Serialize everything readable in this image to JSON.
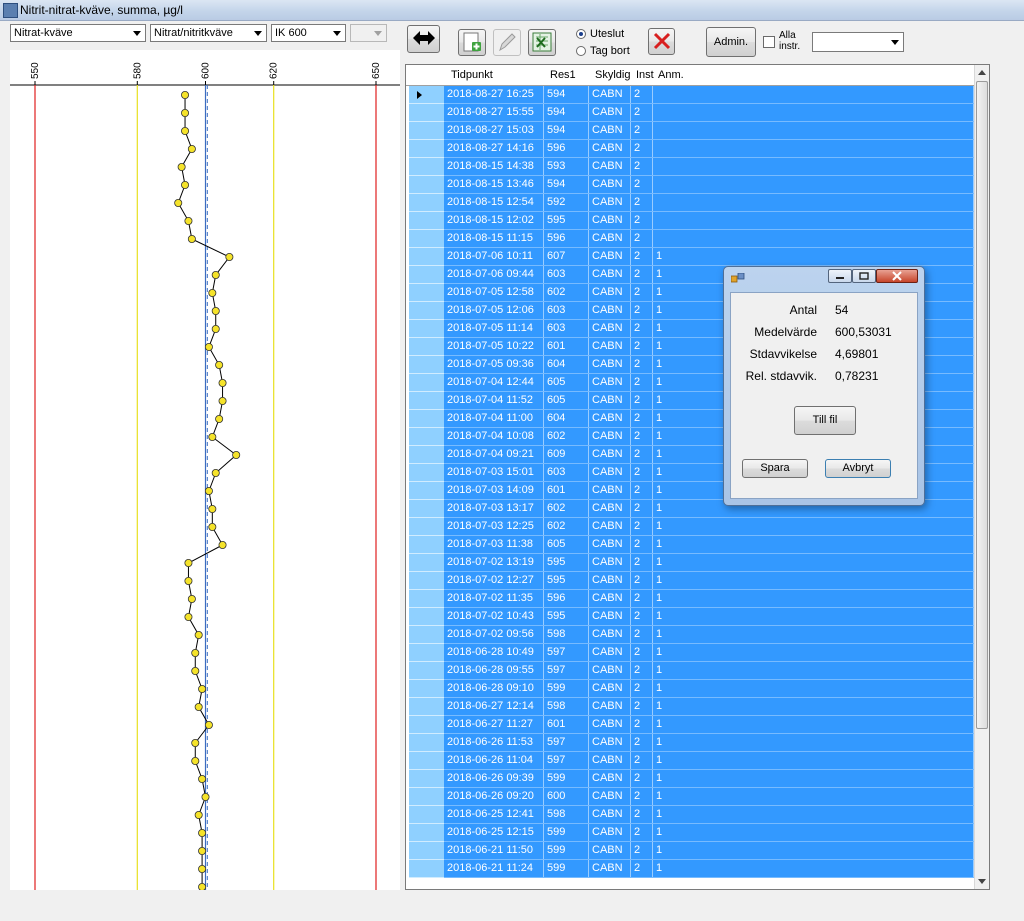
{
  "window": {
    "title": "Nitrit-nitrat-kväve, summa, µg/l"
  },
  "toolbar": {
    "combo1": "Nitrat-kväve",
    "combo2": "Nitrat/nitritkväve",
    "combo3": "IK 600",
    "combo4": "",
    "radio_exclude": "Uteslut",
    "radio_delete": "Tag bort",
    "admin_label": "Admin.",
    "all_instr_label": "Alla instr.",
    "combo5": ""
  },
  "chart_data": {
    "type": "line",
    "orientation": "vertical",
    "x_ticks": [
      "550",
      "580",
      "600",
      "620",
      "650"
    ],
    "xlim": [
      550,
      650
    ],
    "limit_lines": [
      {
        "value": 550,
        "color": "#e02020"
      },
      {
        "value": 580,
        "color": "#e8e020"
      },
      {
        "value": 620,
        "color": "#e8e020"
      },
      {
        "value": 650,
        "color": "#e02020"
      }
    ],
    "target_line": {
      "value": 600,
      "color": "#3b6cc0"
    },
    "mean_line": {
      "value": 600.53,
      "color": "#3b6cc0"
    },
    "point_color": "#f5e32a",
    "values": [
      594,
      594,
      594,
      596,
      593,
      594,
      592,
      595,
      596,
      607,
      603,
      602,
      603,
      603,
      601,
      604,
      605,
      605,
      604,
      602,
      609,
      603,
      601,
      602,
      602,
      605,
      595,
      595,
      596,
      595,
      598,
      597,
      597,
      599,
      598,
      601,
      597,
      597,
      599,
      600,
      598,
      599,
      599,
      599,
      599
    ]
  },
  "grid": {
    "columns": [
      "Tidpunkt",
      "Res1",
      "Skyldig",
      "Inst",
      "Anm."
    ],
    "rows": [
      [
        "2018-08-27 16:25",
        "594",
        "CABN",
        "2",
        ""
      ],
      [
        "2018-08-27 15:55",
        "594",
        "CABN",
        "2",
        ""
      ],
      [
        "2018-08-27 15:03",
        "594",
        "CABN",
        "2",
        ""
      ],
      [
        "2018-08-27 14:16",
        "596",
        "CABN",
        "2",
        ""
      ],
      [
        "2018-08-15 14:38",
        "593",
        "CABN",
        "2",
        ""
      ],
      [
        "2018-08-15 13:46",
        "594",
        "CABN",
        "2",
        ""
      ],
      [
        "2018-08-15 12:54",
        "592",
        "CABN",
        "2",
        ""
      ],
      [
        "2018-08-15 12:02",
        "595",
        "CABN",
        "2",
        ""
      ],
      [
        "2018-08-15 11:15",
        "596",
        "CABN",
        "2",
        ""
      ],
      [
        "2018-07-06 10:11",
        "607",
        "CABN",
        "2",
        "1"
      ],
      [
        "2018-07-06 09:44",
        "603",
        "CABN",
        "2",
        "1"
      ],
      [
        "2018-07-05 12:58",
        "602",
        "CABN",
        "2",
        "1"
      ],
      [
        "2018-07-05 12:06",
        "603",
        "CABN",
        "2",
        "1"
      ],
      [
        "2018-07-05 11:14",
        "603",
        "CABN",
        "2",
        "1"
      ],
      [
        "2018-07-05 10:22",
        "601",
        "CABN",
        "2",
        "1"
      ],
      [
        "2018-07-05 09:36",
        "604",
        "CABN",
        "2",
        "1"
      ],
      [
        "2018-07-04 12:44",
        "605",
        "CABN",
        "2",
        "1"
      ],
      [
        "2018-07-04 11:52",
        "605",
        "CABN",
        "2",
        "1"
      ],
      [
        "2018-07-04 11:00",
        "604",
        "CABN",
        "2",
        "1"
      ],
      [
        "2018-07-04 10:08",
        "602",
        "CABN",
        "2",
        "1"
      ],
      [
        "2018-07-04 09:21",
        "609",
        "CABN",
        "2",
        "1"
      ],
      [
        "2018-07-03 15:01",
        "603",
        "CABN",
        "2",
        "1"
      ],
      [
        "2018-07-03 14:09",
        "601",
        "CABN",
        "2",
        "1"
      ],
      [
        "2018-07-03 13:17",
        "602",
        "CABN",
        "2",
        "1"
      ],
      [
        "2018-07-03 12:25",
        "602",
        "CABN",
        "2",
        "1"
      ],
      [
        "2018-07-03 11:38",
        "605",
        "CABN",
        "2",
        "1"
      ],
      [
        "2018-07-02 13:19",
        "595",
        "CABN",
        "2",
        "1"
      ],
      [
        "2018-07-02 12:27",
        "595",
        "CABN",
        "2",
        "1"
      ],
      [
        "2018-07-02 11:35",
        "596",
        "CABN",
        "2",
        "1"
      ],
      [
        "2018-07-02 10:43",
        "595",
        "CABN",
        "2",
        "1"
      ],
      [
        "2018-07-02 09:56",
        "598",
        "CABN",
        "2",
        "1"
      ],
      [
        "2018-06-28 10:49",
        "597",
        "CABN",
        "2",
        "1"
      ],
      [
        "2018-06-28 09:55",
        "597",
        "CABN",
        "2",
        "1"
      ],
      [
        "2018-06-28 09:10",
        "599",
        "CABN",
        "2",
        "1"
      ],
      [
        "2018-06-27 12:14",
        "598",
        "CABN",
        "2",
        "1"
      ],
      [
        "2018-06-27 11:27",
        "601",
        "CABN",
        "2",
        "1"
      ],
      [
        "2018-06-26 11:53",
        "597",
        "CABN",
        "2",
        "1"
      ],
      [
        "2018-06-26 11:04",
        "597",
        "CABN",
        "2",
        "1"
      ],
      [
        "2018-06-26 09:39",
        "599",
        "CABN",
        "2",
        "1"
      ],
      [
        "2018-06-26 09:20",
        "600",
        "CABN",
        "2",
        "1"
      ],
      [
        "2018-06-25 12:41",
        "598",
        "CABN",
        "2",
        "1"
      ],
      [
        "2018-06-25 12:15",
        "599",
        "CABN",
        "2",
        "1"
      ],
      [
        "2018-06-21 11:50",
        "599",
        "CABN",
        "2",
        "1"
      ],
      [
        "2018-06-21 11:24",
        "599",
        "CABN",
        "2",
        "1"
      ]
    ]
  },
  "dialog": {
    "stats": [
      {
        "label": "Antal",
        "value": "54"
      },
      {
        "label": "Medelvärde",
        "value": "600,53031"
      },
      {
        "label": "Stdavvikelse",
        "value": "4,69801"
      },
      {
        "label": "Rel. stdavvik.",
        "value": "0,78231"
      }
    ],
    "to_file_label": "Till fil",
    "save_label": "Spara",
    "cancel_label": "Avbryt"
  }
}
